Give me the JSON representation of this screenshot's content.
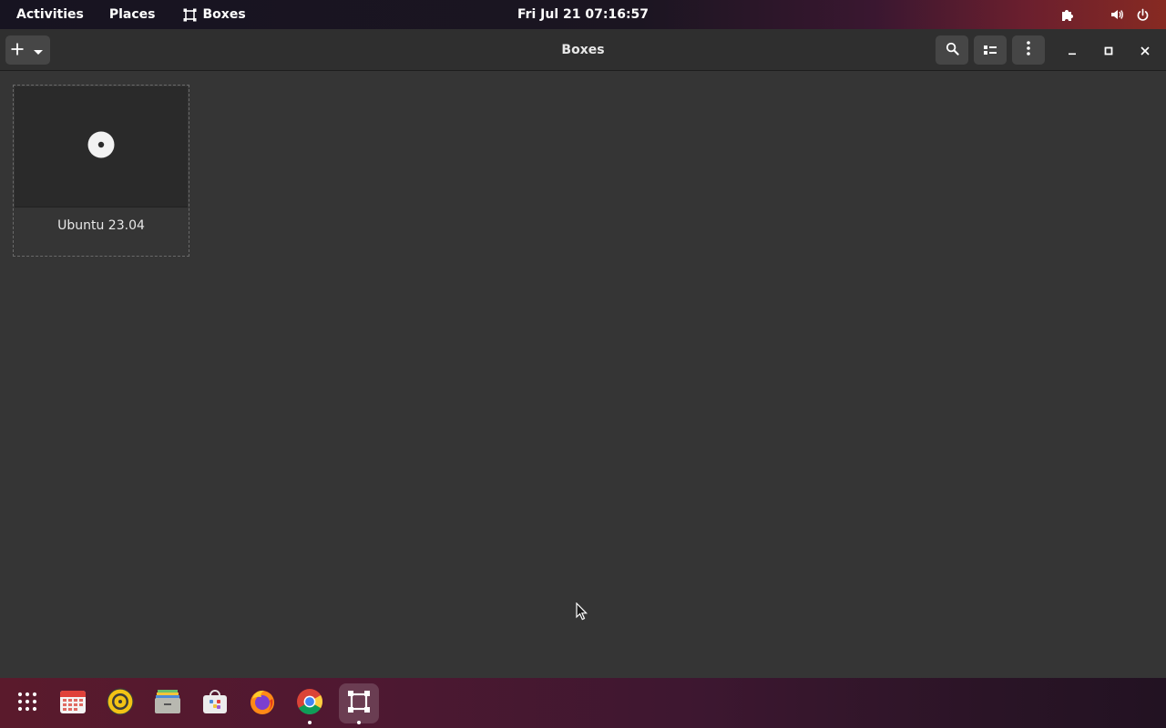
{
  "topbar": {
    "activities_label": "Activities",
    "places_label": "Places",
    "app_label": "Boxes",
    "clock": "Fri Jul 21  07:16:57"
  },
  "headerbar": {
    "title": "Boxes"
  },
  "machines": [
    {
      "name": "Ubuntu 23.04",
      "thumbnail_icon": "disc-icon"
    }
  ],
  "dock": {
    "items": [
      {
        "name": "show-apps-icon",
        "running": false
      },
      {
        "name": "calendar-icon",
        "running": false
      },
      {
        "name": "rhythmbox-icon",
        "running": false
      },
      {
        "name": "files-icon",
        "running": false
      },
      {
        "name": "software-icon",
        "running": false
      },
      {
        "name": "firefox-icon",
        "running": false
      },
      {
        "name": "chrome-icon",
        "running": true
      },
      {
        "name": "boxes-icon",
        "running": true,
        "active": true
      }
    ]
  },
  "colors": {
    "window_bg": "#353535",
    "headerbar_bg": "#2f2f2f",
    "button_bg": "#464646",
    "topbar_bg": "#171421",
    "dock_accent": "#5a1a2c"
  }
}
